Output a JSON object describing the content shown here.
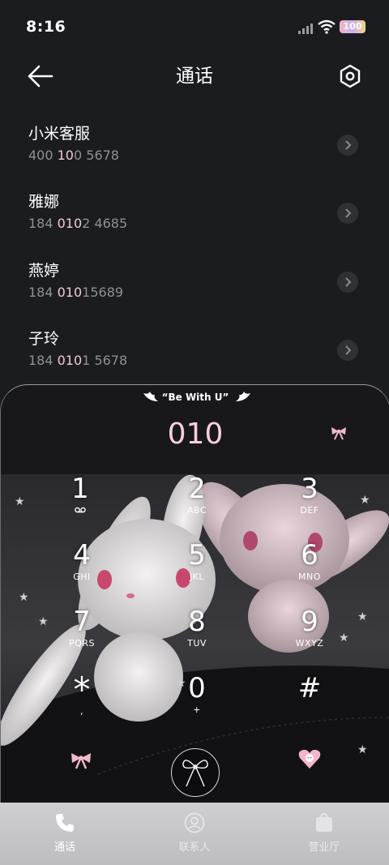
{
  "status": {
    "time": "8:16",
    "battery": "100"
  },
  "header": {
    "title": "通话"
  },
  "contacts": [
    {
      "name": "小米客服",
      "number_pre": "400 ",
      "number_hl1": "10",
      "number_mid": "0",
      "number_hl2": "",
      "number_post": " 5678"
    },
    {
      "name": "雅娜",
      "number_pre": "184 ",
      "number_hl1": "010",
      "number_mid": "2 4685",
      "number_hl2": "",
      "number_post": ""
    },
    {
      "name": "燕婷",
      "number_pre": "184 ",
      "number_hl1": "010",
      "number_mid": "15689",
      "number_hl2": "",
      "number_post": ""
    },
    {
      "name": "子玲",
      "number_pre": "184 ",
      "number_hl1": "010",
      "number_mid": "1 5678",
      "number_hl2": "",
      "number_post": ""
    }
  ],
  "dialer": {
    "theme_label": "“Be With U”",
    "entered": "010",
    "keys": [
      {
        "digit": "1",
        "letters": ""
      },
      {
        "digit": "2",
        "letters": "ABC"
      },
      {
        "digit": "3",
        "letters": "DEF"
      },
      {
        "digit": "4",
        "letters": "GHI"
      },
      {
        "digit": "5",
        "letters": "JKL"
      },
      {
        "digit": "6",
        "letters": "MNO"
      },
      {
        "digit": "7",
        "letters": "PQRS"
      },
      {
        "digit": "8",
        "letters": "TUV"
      },
      {
        "digit": "9",
        "letters": "WXYZ"
      },
      {
        "digit": "*",
        "letters": ","
      },
      {
        "digit": "0",
        "letters": "+"
      },
      {
        "digit": "#",
        "letters": ""
      }
    ]
  },
  "tabs": [
    {
      "label": "通话",
      "active": true
    },
    {
      "label": "联系人",
      "active": false
    },
    {
      "label": "营业厅",
      "active": false
    }
  ],
  "colors": {
    "accent_pink": "#f7cfe0",
    "background": "#1b1c1f",
    "secondary_text": "#8f9196"
  }
}
